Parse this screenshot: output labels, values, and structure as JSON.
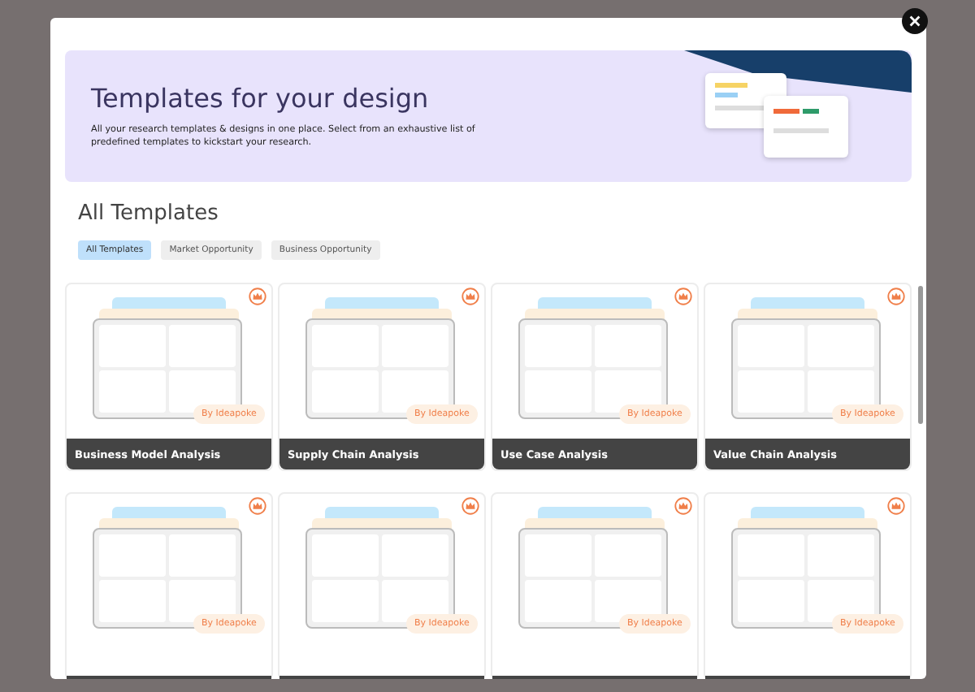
{
  "banner": {
    "title": "Templates for your design",
    "description": "All your research templates & designs in one place. Select from an exhaustive list of predefined templates to kickstart your research."
  },
  "section_title": "All Templates",
  "filters": [
    {
      "label": "All Templates",
      "selected": true
    },
    {
      "label": "Market Opportunity",
      "selected": false
    },
    {
      "label": "Business Opportunity",
      "selected": false
    }
  ],
  "templates": [
    {
      "title": "Business Model Analysis",
      "badge": "By Ideapoke"
    },
    {
      "title": "Supply Chain Analysis",
      "badge": "By Ideapoke"
    },
    {
      "title": "Use Case Analysis",
      "badge": "By Ideapoke"
    },
    {
      "title": "Value Chain Analysis",
      "badge": "By Ideapoke"
    },
    {
      "badge": "By Ideapoke"
    },
    {
      "badge": "By Ideapoke"
    },
    {
      "badge": "By Ideapoke"
    },
    {
      "badge": "By Ideapoke"
    }
  ]
}
